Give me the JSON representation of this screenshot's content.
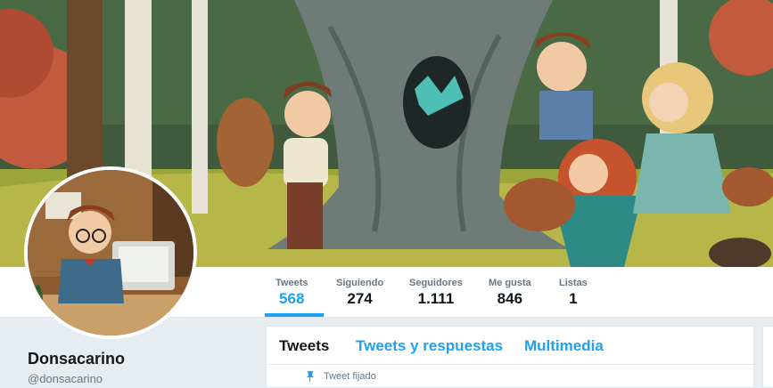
{
  "stats": [
    {
      "label": "Tweets",
      "value": "568"
    },
    {
      "label": "Siguiendo",
      "value": "274"
    },
    {
      "label": "Seguidores",
      "value": "1.111"
    },
    {
      "label": "Me gusta",
      "value": "846"
    },
    {
      "label": "Listas",
      "value": "1"
    }
  ],
  "profile": {
    "name": "Donsacarino",
    "handle": "@donsacarino"
  },
  "tabs": [
    {
      "label": "Tweets"
    },
    {
      "label": "Tweets y respuestas"
    },
    {
      "label": "Multimedia"
    }
  ],
  "pinned": {
    "label": "Tweet fijado",
    "icon": "pin-icon"
  },
  "colors": {
    "accent": "#1da1f2",
    "text": "#14171a",
    "muted": "#657786",
    "page_bg": "#e6ecf0"
  },
  "images": {
    "banner": "forest-illustration-banner",
    "avatar": "boy-at-computer-illustration"
  }
}
